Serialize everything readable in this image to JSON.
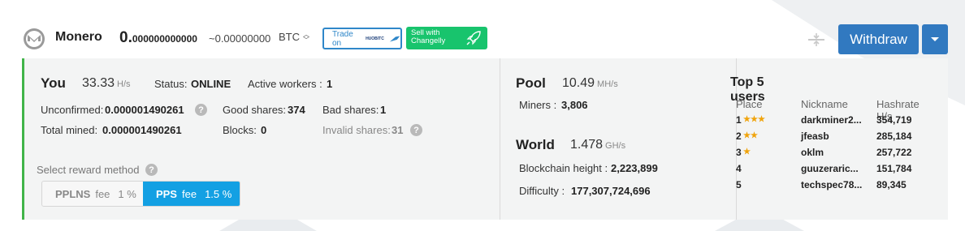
{
  "header": {
    "coin_name": "Monero",
    "balance_int": "0.",
    "balance_dec": "000000000000",
    "btc_approx": "~0.00000000",
    "currency": "BTC",
    "trade_label": "Trade on",
    "trade_logo_text": "HUOBITC",
    "changelly_label": "Sell with Changelly",
    "withdraw_label": "Withdraw",
    "colors": {
      "primary": "#3179c0",
      "changelly": "#18c46d",
      "accent_border": "#41b449"
    }
  },
  "you": {
    "title": "You",
    "hashrate": "33.33",
    "hashrate_unit": "H/s",
    "status_label": "Status:",
    "status_value": "ONLINE",
    "workers_label": "Active workers :",
    "workers_value": "1",
    "unconfirmed_label": "Unconfirmed:",
    "unconfirmed_value": "0.000001490261",
    "good_shares_label": "Good shares:",
    "good_shares_value": "374",
    "bad_shares_label": "Bad shares:",
    "bad_shares_value": "1",
    "total_mined_label": "Total mined:",
    "total_mined_value": "0.000001490261",
    "blocks_label": "Blocks:",
    "blocks_value": "0",
    "invalid_shares_label": "Invalid shares:",
    "invalid_shares_value": "31",
    "help_glyph": "?"
  },
  "reward": {
    "label": "Select reward method",
    "methods": [
      {
        "name": "PPLNS",
        "fee_label": "fee",
        "fee_value": "1 %",
        "selected": false
      },
      {
        "name": "PPS",
        "fee_label": "fee",
        "fee_value": "1.5 %",
        "selected": true
      }
    ]
  },
  "pool": {
    "title": "Pool",
    "hashrate": "10.49",
    "hashrate_unit": "MH/s",
    "miners_label": "Miners :",
    "miners_value": "3,806"
  },
  "world": {
    "title": "World",
    "hashrate": "1.478",
    "hashrate_unit": "GH/s",
    "height_label": "Blockchain height :",
    "height_value": "2,223,899",
    "difficulty_label": "Difficulty :",
    "difficulty_value": "177,307,724,696"
  },
  "top_users": {
    "title": "Top 5 users",
    "columns": [
      "Place",
      "Nickname",
      "Hashrate H/s"
    ],
    "rows": [
      {
        "place": "1",
        "stars": 3,
        "nickname": "darkminer2...",
        "hashrate": "354,719"
      },
      {
        "place": "2",
        "stars": 2,
        "nickname": "jfeasb",
        "hashrate": "285,184"
      },
      {
        "place": "3",
        "stars": 1,
        "nickname": "oklm",
        "hashrate": "257,722"
      },
      {
        "place": "4",
        "stars": 0,
        "nickname": "guuzeraric...",
        "hashrate": "151,784"
      },
      {
        "place": "5",
        "stars": 0,
        "nickname": "techspec78...",
        "hashrate": "89,345"
      }
    ]
  }
}
